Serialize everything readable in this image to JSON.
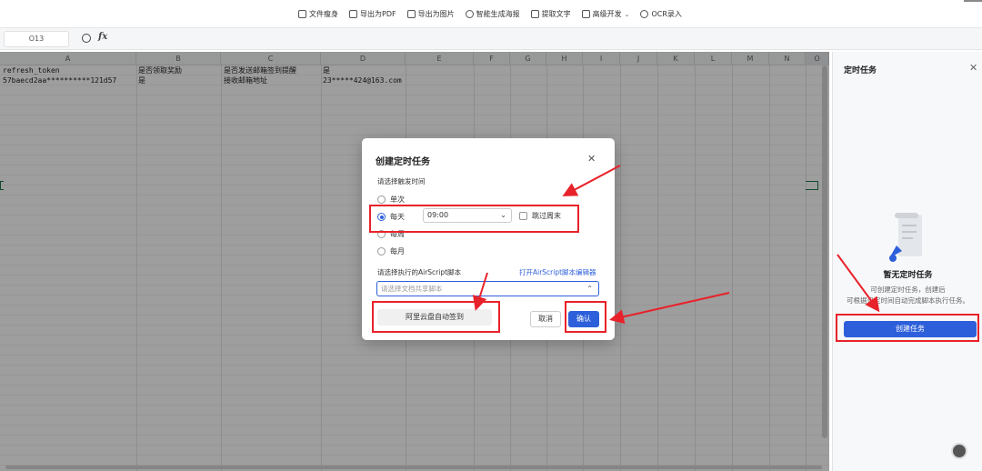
{
  "toolbar": {
    "items": [
      {
        "label": "文件瘦身",
        "icon": "file-slim-icon"
      },
      {
        "label": "导出为PDF",
        "icon": "pdf-icon"
      },
      {
        "label": "导出为图片",
        "icon": "image-icon"
      },
      {
        "label": "智能生成海报",
        "icon": "poster-icon"
      },
      {
        "label": "提取文字",
        "icon": "extract-text-icon"
      },
      {
        "label": "高级开发",
        "icon": "dev-icon"
      },
      {
        "label": "OCR录入",
        "icon": "ocr-icon"
      }
    ]
  },
  "formula_bar": {
    "cell_ref": "O13",
    "fx": "fx"
  },
  "grid": {
    "columns": [
      "A",
      "B",
      "C",
      "D",
      "E",
      "F",
      "G",
      "H",
      "I",
      "J",
      "K",
      "L",
      "M",
      "N",
      "O"
    ],
    "rows": [
      [
        "refresh_token",
        "是否领取奖励",
        "是否发送邮箱签到提醒",
        "是"
      ],
      [
        "57baecd2aa**********121d57",
        "是",
        "接收邮箱地址",
        "23*****",
        "424@163.com"
      ]
    ]
  },
  "panel": {
    "title": "定时任务",
    "empty_title": "暂无定时任务",
    "empty_desc_1": "可创建定时任务，创建后",
    "empty_desc_2": "可根据设定时间自动完成脚本执行任务。",
    "create_button": "创建任务"
  },
  "dialog": {
    "title": "创建定时任务",
    "trigger_label": "请选择触发时间",
    "options": [
      "单次",
      "每天",
      "每周",
      "每月"
    ],
    "selected_option": "每天",
    "time_value": "09:00",
    "skip_weekend": "跳过周末",
    "script_label": "请选择执行的AirScript脚本",
    "script_link": "打开AirScript脚本编辑器",
    "script_placeholder": "请选择文档共享脚本",
    "script_option": "阿里云盘自动签到",
    "cancel": "取消",
    "confirm": "确认"
  },
  "colors": {
    "accent": "#2d5fda",
    "annotation": "#e8222a"
  }
}
